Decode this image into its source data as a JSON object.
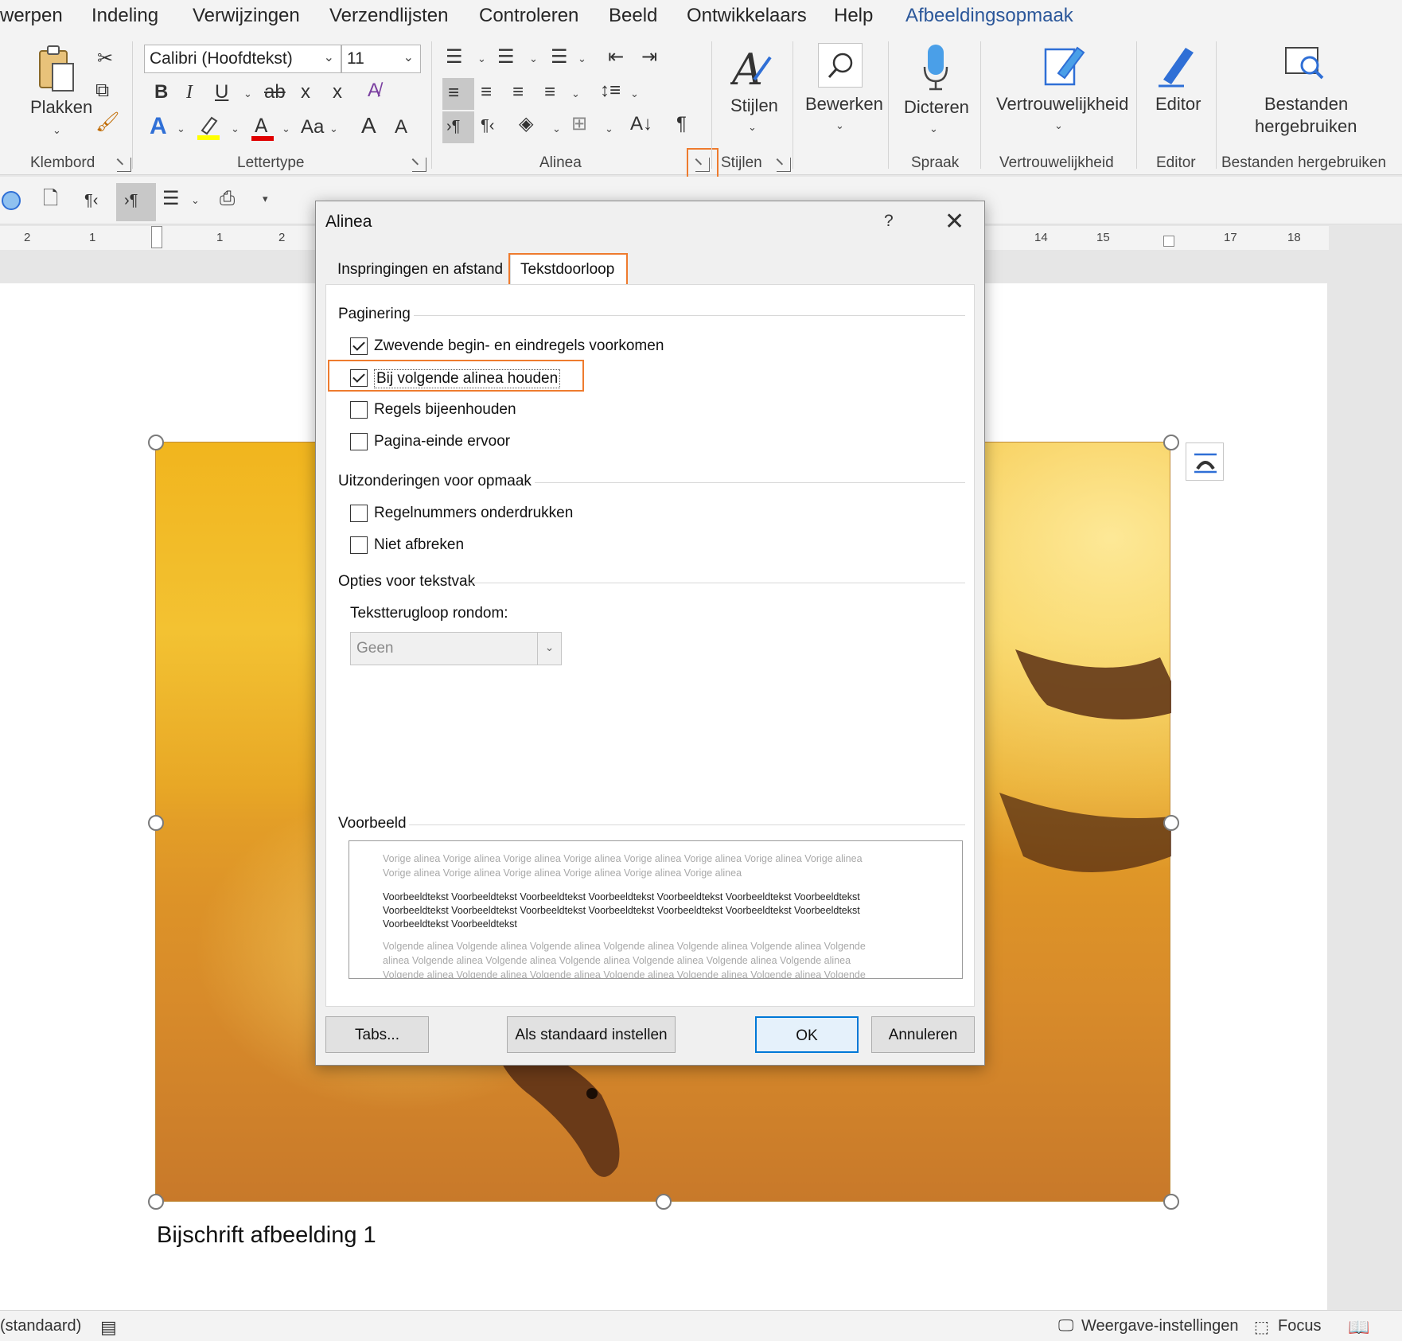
{
  "menu": {
    "items": [
      "werpen",
      "Indeling",
      "Verwijzingen",
      "Verzendlijsten",
      "Controleren",
      "Beeld",
      "Ontwikkelaars",
      "Help",
      "Afbeeldingsopmaak"
    ]
  },
  "ribbon": {
    "clipboard": {
      "paste_label": "Plakken",
      "group": "Klembord"
    },
    "font": {
      "name": "Calibri (Hoofdtekst)",
      "size": "11",
      "group": "Lettertype",
      "bold": "B",
      "italic": "I",
      "underline": "U",
      "strike": "ab",
      "subscript": "x",
      "superscript": "x",
      "case": "Aa",
      "grow": "A",
      "shrink": "A",
      "highlight_color": "#ffff00",
      "font_color": "#e00000"
    },
    "paragraph": {
      "group": "Alinea"
    },
    "styles": {
      "label": "Stijlen",
      "group": "Stijlen"
    },
    "edit": {
      "label": "Bewerken"
    },
    "dictate": {
      "label": "Dicteren",
      "group": "Spraak"
    },
    "privacy": {
      "label": "Vertrouwelijkheid",
      "group": "Vertrouwelijkheid"
    },
    "editor": {
      "label": "Editor",
      "group": "Editor"
    },
    "reuse": {
      "label_line1": "Bestanden",
      "label_line2": "hergebruiken",
      "group": "Bestanden hergebruiken"
    }
  },
  "ruler": {
    "numbers": [
      "2",
      "1",
      "1",
      "2",
      "14",
      "15",
      "17",
      "18"
    ]
  },
  "document": {
    "caption": "Bijschrift afbeelding 1"
  },
  "dialog": {
    "title": "Alinea",
    "help": "?",
    "close": "✕",
    "tabs": [
      "Inspringingen en afstand",
      "Tekstdoorloop"
    ],
    "active_tab": "Tekstdoorloop",
    "sections": {
      "pagination": "Paginering",
      "exceptions": "Uitzonderingen voor opmaak",
      "textbox": "Opties voor tekstvak",
      "preview": "Voorbeeld"
    },
    "checkboxes": {
      "widow": {
        "label": "Zwevende begin- en eindregels voorkomen",
        "checked": true
      },
      "keep_next": {
        "label": "Bij volgende alinea houden",
        "checked": true
      },
      "keep_lines": {
        "label": "Regels bijeenhouden",
        "checked": false
      },
      "page_break": {
        "label": "Pagina-einde ervoor",
        "checked": false
      },
      "suppress_lines": {
        "label": "Regelnummers onderdrukken",
        "checked": false
      },
      "no_hyphen": {
        "label": "Niet afbreken",
        "checked": false
      }
    },
    "wrap_label": "Tekstterugloop rondom:",
    "wrap_value": "Geen",
    "preview": {
      "prev_1": "Vorige alinea Vorige alinea Vorige alinea Vorige alinea Vorige alinea Vorige alinea Vorige alinea Vorige alinea",
      "prev_2": "Vorige alinea Vorige alinea Vorige alinea Vorige alinea Vorige alinea Vorige alinea",
      "sample_1": "Voorbeeldtekst Voorbeeldtekst Voorbeeldtekst Voorbeeldtekst Voorbeeldtekst Voorbeeldtekst Voorbeeldtekst",
      "sample_2": "Voorbeeldtekst Voorbeeldtekst Voorbeeldtekst Voorbeeldtekst Voorbeeldtekst Voorbeeldtekst Voorbeeldtekst",
      "sample_3": "Voorbeeldtekst Voorbeeldtekst",
      "next_1": "Volgende alinea Volgende alinea Volgende alinea Volgende alinea Volgende alinea Volgende alinea Volgende",
      "next_2": "alinea Volgende alinea Volgende alinea Volgende alinea Volgende alinea Volgende alinea Volgende alinea",
      "next_3": "Volgende alinea Volgende alinea Volgende alinea Volgende alinea Volgende alinea Volgende alinea Volgende"
    },
    "buttons": {
      "tabs": "Tabs...",
      "default": "Als standaard instellen",
      "ok": "OK",
      "cancel": "Annuleren"
    }
  },
  "status": {
    "style": "(standaard)",
    "display_settings": "Weergave-instellingen",
    "focus": "Focus"
  },
  "colors": {
    "accent": "#2b579a",
    "highlight_box": "#ee7b2e",
    "ok_border": "#0078d7"
  }
}
